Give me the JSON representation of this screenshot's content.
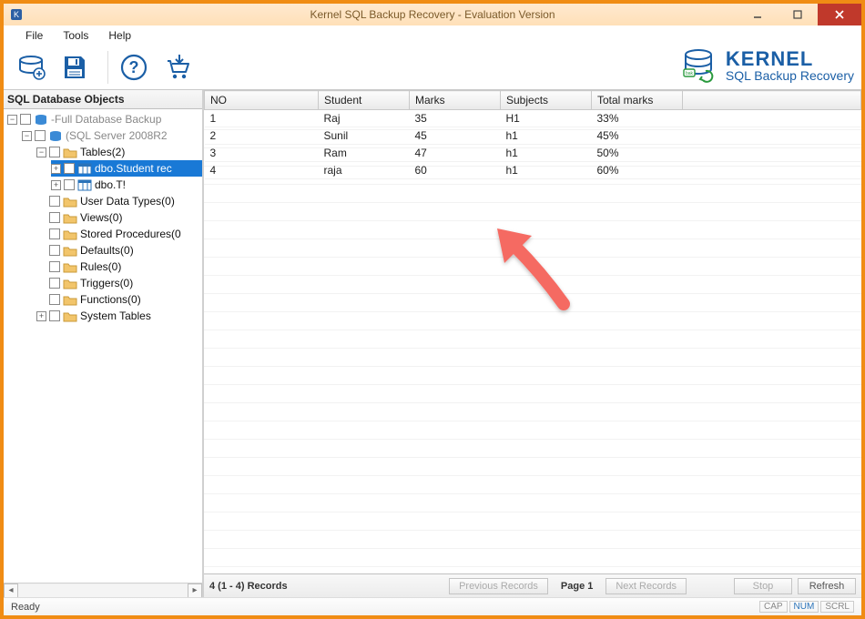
{
  "window": {
    "title": "Kernel SQL Backup Recovery - Evaluation Version"
  },
  "menu": {
    "file": "File",
    "tools": "Tools",
    "help": "Help"
  },
  "branding": {
    "line1": "Kernel",
    "line2": "SQL Backup Recovery"
  },
  "sidebar": {
    "header": "SQL Database Objects",
    "root_label": "-Full Database Backup",
    "server_label": "(SQL Server 2008R2",
    "tables_label": "Tables(2)",
    "item_student": "dbo.Student rec",
    "item_t": "dbo.T!",
    "user_data_types": "User Data Types(0)",
    "views": "Views(0)",
    "stored_procs": "Stored Procedures(0",
    "defaults": "Defaults(0)",
    "rules": "Rules(0)",
    "triggers": "Triggers(0)",
    "functions": "Functions(0)",
    "system_tables": "System Tables"
  },
  "grid": {
    "columns": [
      "NO",
      "Student",
      "Marks",
      "Subjects",
      "Total marks"
    ],
    "rows": [
      {
        "no": "1",
        "student": "Raj",
        "marks": "35",
        "subjects": "H1",
        "total": "33%"
      },
      {
        "no": "2",
        "student": "Sunil",
        "marks": "45",
        "subjects": "h1",
        "total": "45%"
      },
      {
        "no": "3",
        "student": "Ram",
        "marks": "47",
        "subjects": "h1",
        "total": "50%"
      },
      {
        "no": "4",
        "student": "raja",
        "marks": "60",
        "subjects": "h1",
        "total": "60%"
      }
    ]
  },
  "pager": {
    "records_info": "4 (1 - 4) Records",
    "prev": "Previous Records",
    "page": "Page 1",
    "next": "Next Records",
    "stop": "Stop",
    "refresh": "Refresh"
  },
  "status": {
    "ready": "Ready",
    "cap": "CAP",
    "num": "NUM",
    "scrl": "SCRL"
  }
}
